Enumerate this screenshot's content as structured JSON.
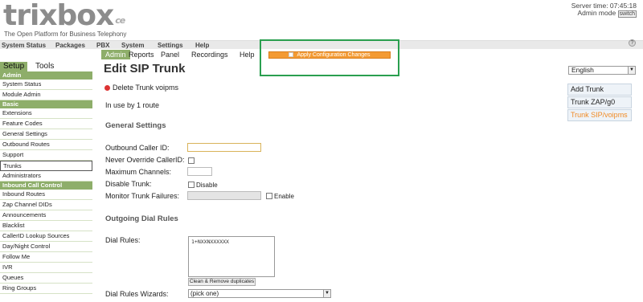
{
  "header": {
    "logo_text": "trixbox",
    "logo_suffix": "ce",
    "tagline": "The Open Platform for Business Telephony",
    "server_time": "Server time: 07:45:18",
    "admin_mode": "Admin mode",
    "switch_label": "switch"
  },
  "main_menu": [
    "System Status",
    "Packages",
    "PBX",
    "System",
    "Settings",
    "Help"
  ],
  "help_icon": "?",
  "sub_menu": {
    "items": [
      "Admin",
      "Reports",
      "Panel",
      "Recordings",
      "Help"
    ],
    "active": "Admin",
    "apply_label": "Apply Configuration Changes"
  },
  "sidebar": {
    "tabs": [
      "Setup",
      "Tools"
    ],
    "sections": [
      {
        "title": "Admin",
        "items": [
          "System Status",
          "Module Admin"
        ]
      },
      {
        "title": "Basic",
        "items": [
          "Extensions",
          "Feature Codes",
          "General Settings",
          "Outbound Routes",
          "Support",
          "Trunks",
          "Administrators"
        ]
      },
      {
        "title": "Inbound Call Control",
        "items": [
          "Inbound Routes",
          "Zap Channel DIDs",
          "Announcements",
          "Blacklist",
          "CallerID Lookup Sources",
          "Day/Night Control",
          "Follow Me",
          "IVR",
          "Queues",
          "Ring Groups"
        ]
      }
    ],
    "selected": "Trunks"
  },
  "content": {
    "title": "Edit SIP Trunk",
    "delete_label": "Delete Trunk voipms",
    "in_use": "In use by 1 route",
    "general_settings": "General Settings",
    "outbound_caller_id": "Outbound Caller ID:",
    "never_override": "Never Override CallerID:",
    "max_channels": "Maximum Channels:",
    "disable_trunk": "Disable Trunk:",
    "disable_label": "Disable",
    "monitor_failures": "Monitor Trunk Failures:",
    "enable_label": "Enable",
    "outgoing_dial_rules": "Outgoing Dial Rules",
    "dial_rules": "Dial Rules:",
    "dial_rules_value": "1+NXXNXXXXXX",
    "clean_button": "Clean & Remove duplicates",
    "dial_rules_wizards": "Dial Rules Wizards:",
    "wizard_value": "(pick one)"
  },
  "right_panel": {
    "language": "English",
    "trunk_links": [
      "Add Trunk",
      "Trunk ZAP/g0",
      "Trunk SIP/voipms"
    ],
    "current": "Trunk SIP/voipms"
  },
  "colors": {
    "accent_green": "#8eae6a",
    "apply_orange": "#f39a33",
    "highlight_green": "#2a9f4f"
  }
}
